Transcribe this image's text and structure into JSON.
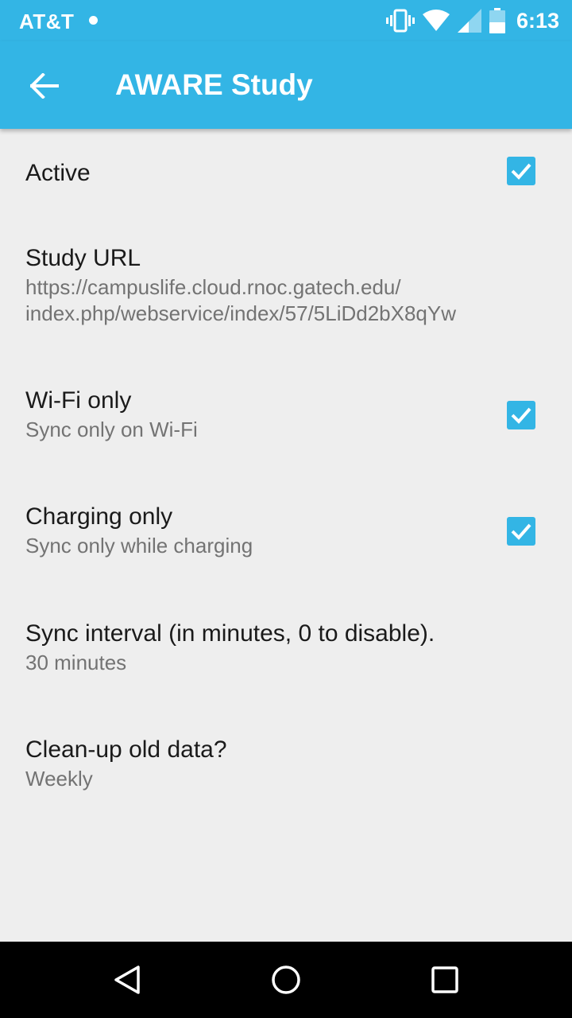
{
  "status_bar": {
    "carrier": "AT&T",
    "time": "6:13",
    "icons": [
      "notification-dot-icon",
      "vibrate-icon",
      "wifi-icon",
      "cell-signal-icon",
      "battery-icon"
    ]
  },
  "action_bar": {
    "title": "AWARE Study",
    "back_icon": "arrow-back-icon"
  },
  "preferences": [
    {
      "title": "Active",
      "summary": "",
      "checkbox": true,
      "checked": true
    },
    {
      "title": "Study URL",
      "summary": "https://campuslife.cloud.rnoc.gatech.edu/\nindex.php/webservice/index/57/5LiDd2bX8qYw",
      "checkbox": false
    },
    {
      "title": "Wi-Fi only",
      "summary": "Sync only on Wi-Fi",
      "checkbox": true,
      "checked": true
    },
    {
      "title": "Charging only",
      "summary": "Sync only while charging",
      "checkbox": true,
      "checked": true
    },
    {
      "title": "Sync interval (in minutes, 0 to disable).",
      "summary": "30 minutes",
      "checkbox": false
    },
    {
      "title": "Clean-up old data?",
      "summary": "Weekly",
      "checkbox": false
    }
  ],
  "nav_bar": {
    "buttons": [
      "back-triangle-icon",
      "home-circle-icon",
      "recents-square-icon"
    ]
  },
  "colors": {
    "accent": "#33b5e5",
    "background": "#eeeeee",
    "title_text": "#1a1a1a",
    "summary_text": "#737373"
  }
}
